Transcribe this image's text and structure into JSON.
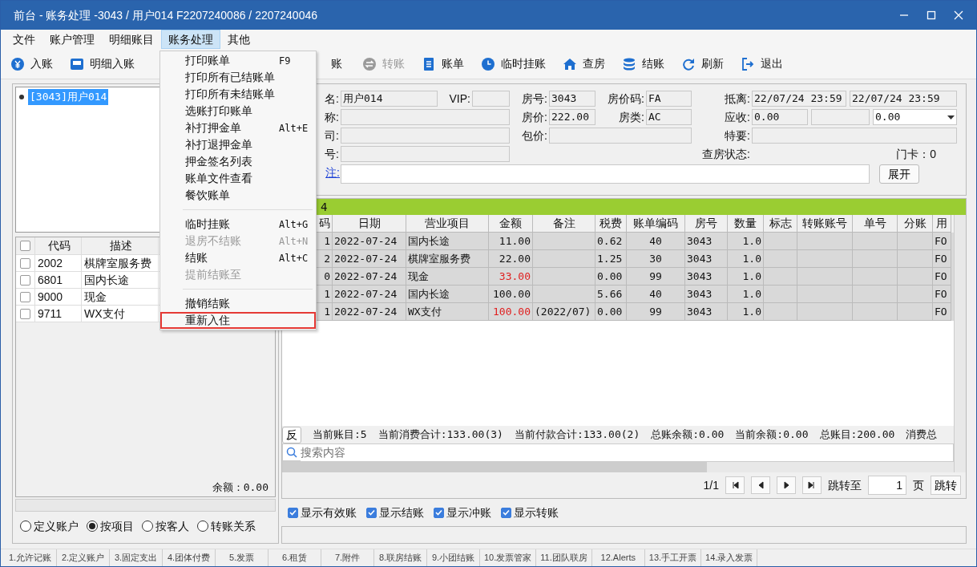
{
  "window": {
    "title": "前台 - 账务处理 -3043 / 用户014  F2207240086 / 2207240046"
  },
  "menu_bar": [
    {
      "label": "文件",
      "selected": false
    },
    {
      "label": "账户管理",
      "selected": false
    },
    {
      "label": "明细账目",
      "selected": false
    },
    {
      "label": "账务处理",
      "selected": true
    },
    {
      "label": "其他",
      "selected": false
    }
  ],
  "toolbar": [
    {
      "label": "入账",
      "disabled": false
    },
    {
      "label": "明细入账",
      "disabled": false
    },
    {
      "label": "账",
      "disabled": false
    },
    {
      "label": "转账",
      "disabled": true
    },
    {
      "label": "账单",
      "disabled": false
    },
    {
      "label": "临时挂账",
      "disabled": false
    },
    {
      "label": "查房",
      "disabled": false
    },
    {
      "label": "结账",
      "disabled": false
    },
    {
      "label": "刷新",
      "disabled": false
    },
    {
      "label": "退出",
      "disabled": false
    }
  ],
  "dropdown_menu": [
    {
      "kind": "item",
      "label": "打印账单",
      "shortcut": "F9",
      "disabled": false,
      "highlighted": false
    },
    {
      "kind": "item",
      "label": "打印所有已结账单",
      "disabled": false,
      "highlighted": false
    },
    {
      "kind": "item",
      "label": "打印所有未结账单",
      "disabled": false,
      "highlighted": false
    },
    {
      "kind": "item",
      "label": "选账打印账单",
      "disabled": false,
      "highlighted": false
    },
    {
      "kind": "item",
      "label": "补打押金单",
      "shortcut": "Alt+E",
      "disabled": false,
      "highlighted": false
    },
    {
      "kind": "item",
      "label": "补打退押金单",
      "disabled": false,
      "highlighted": false
    },
    {
      "kind": "item",
      "label": "押金签名列表",
      "disabled": false,
      "highlighted": false
    },
    {
      "kind": "item",
      "label": "账单文件查看",
      "disabled": false,
      "highlighted": false
    },
    {
      "kind": "item",
      "label": "餐饮账单",
      "disabled": false,
      "highlighted": false
    },
    {
      "kind": "separator"
    },
    {
      "kind": "item",
      "label": "临时挂账",
      "shortcut": "Alt+G",
      "disabled": false,
      "highlighted": false
    },
    {
      "kind": "item",
      "label": "退房不结账",
      "shortcut": "Alt+N",
      "disabled": true,
      "highlighted": false
    },
    {
      "kind": "item",
      "label": "结账",
      "shortcut": "Alt+C",
      "disabled": false,
      "highlighted": false
    },
    {
      "kind": "item",
      "label": "提前结账至",
      "disabled": true,
      "highlighted": false
    },
    {
      "kind": "separator"
    },
    {
      "kind": "item",
      "label": "撤销结账",
      "disabled": false,
      "highlighted": false
    },
    {
      "kind": "item",
      "label": "重新入住",
      "disabled": false,
      "highlighted": true
    }
  ],
  "guest_tree": [
    {
      "label": "[3043]用户014",
      "selected": true
    }
  ],
  "item_list": {
    "header_checked": false,
    "columns": [
      "代码",
      "描述"
    ],
    "rows": [
      {
        "checked": false,
        "code": "2002",
        "description": "棋牌室服务费"
      },
      {
        "checked": false,
        "code": "6801",
        "description": "国内长途"
      },
      {
        "checked": false,
        "code": "9000",
        "description": "现金"
      },
      {
        "checked": false,
        "code": "9711",
        "description": "WX支付"
      }
    ],
    "balance": "余额：0.00"
  },
  "view_modes": [
    {
      "label": "定义账户",
      "selected": false
    },
    {
      "label": "按项目",
      "selected": true
    },
    {
      "label": "按客人",
      "selected": false
    },
    {
      "label": "转账关系",
      "selected": false
    }
  ],
  "guest_form": {
    "fields": [
      {
        "kind": "field",
        "label": "名:",
        "value": "用户014"
      },
      {
        "kind": "field",
        "label": "VIP:"
      },
      {
        "kind": "field",
        "label": "房号:",
        "value": "3043"
      },
      {
        "kind": "field",
        "label": "房价码:",
        "value": "FA"
      },
      {
        "kind": "field",
        "label": "抵离:",
        "value": "22/07/24 23:59"
      },
      {
        "kind": "field",
        "value": "22/07/24 23:59"
      },
      {
        "kind": "field",
        "label": "称:"
      },
      {
        "kind": "field",
        "label": "房价:",
        "value": "222.00"
      },
      {
        "kind": "field",
        "label": "房类:",
        "value": "AC"
      },
      {
        "kind": "field",
        "label": "应收:",
        "value": "0.00"
      },
      {
        "kind": "field"
      },
      {
        "kind": "select",
        "value": "0.00"
      },
      {
        "kind": "field",
        "label": "司:"
      },
      {
        "kind": "field",
        "label": "包价:"
      },
      {
        "kind": "field",
        "label": "特要:"
      },
      {
        "kind": "field",
        "label": "号:"
      },
      {
        "kind": "text",
        "label": "查房状态:"
      },
      {
        "kind": "text",
        "label": "门卡：0"
      },
      {
        "kind": "link",
        "label": "注:"
      }
    ],
    "expand_button": "展开"
  },
  "ledger": {
    "group_label": "4",
    "columns": [
      "码",
      "日期",
      "营业项目",
      "金额",
      "备注",
      "税费",
      "账单编码",
      "房号",
      "数量",
      "标志",
      "转账账号",
      "单号",
      "分账",
      "用"
    ],
    "rows": [
      {
        "kind": "charge",
        "cells": [
          "1",
          "2022-07-24",
          "国内长途",
          "11.00",
          null,
          "0.62",
          "40",
          "3043",
          "1.0",
          null,
          null,
          null,
          null,
          "FO"
        ]
      },
      {
        "kind": "charge",
        "cells": [
          "2",
          "2022-07-24",
          "棋牌室服务费",
          "22.00",
          null,
          "1.25",
          "30",
          "3043",
          "1.0",
          null,
          null,
          null,
          null,
          "FO"
        ]
      },
      {
        "kind": "payment",
        "cells": [
          "0",
          "2022-07-24",
          "现金",
          "33.00",
          null,
          "0.00",
          "99",
          "3043",
          "1.0",
          null,
          null,
          null,
          null,
          "FO"
        ]
      },
      {
        "kind": "charge",
        "cells": [
          "1",
          "2022-07-24",
          "国内长途",
          "100.00",
          null,
          "5.66",
          "40",
          "3043",
          "1.0",
          null,
          null,
          null,
          null,
          "FO"
        ]
      },
      {
        "kind": "payment",
        "cells": [
          "1",
          "2022-07-24",
          "WX支付",
          "100.00",
          "(2022/07)",
          "0.00",
          "99",
          "3043",
          "1.0",
          null,
          null,
          null,
          null,
          "FO"
        ]
      }
    ],
    "reverse_button": "反",
    "summary": [
      "当前账目:5",
      "当前消费合计:133.00(3)",
      "当前付款合计:133.00(2)",
      "总账余额:0.00",
      "当前余额:0.00",
      "总账目:200.00",
      "消费总"
    ],
    "search": {
      "placeholder": "搜索内容"
    },
    "pager": {
      "page": "1/1",
      "jump_label": "跳转至",
      "page_input": "1",
      "page_unit": "页",
      "jump_button": "跳转"
    }
  },
  "filters": [
    {
      "label": "显示有效账",
      "checked": true
    },
    {
      "label": "显示结账",
      "checked": true
    },
    {
      "label": "显示冲账",
      "checked": true
    },
    {
      "label": "显示转账",
      "checked": true
    }
  ],
  "bottom_tabs": [
    "1.允许记账",
    "2.定义账户",
    "3.固定支出",
    "4.团体付费",
    "5.发票",
    "6.租赁",
    "7.附件",
    "8.联房结账",
    "9.小团结账",
    "10.发票管家",
    "11.团队联房",
    "12.Alerts",
    "13.手工开票",
    "14.录入发票"
  ]
}
